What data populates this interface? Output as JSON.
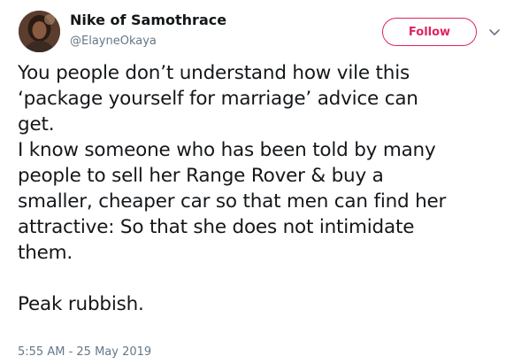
{
  "author": {
    "display_name": "Nike of Samothrace",
    "handle": "@ElayneOkaya"
  },
  "actions": {
    "follow_label": "Follow",
    "caret_icon": "chevron-down-icon"
  },
  "tweet": {
    "lines": [
      "You people don’t understand how vile this",
      "‘package yourself for marriage’ advice can",
      "get.",
      "I know someone who has been told by many",
      "people to sell her Range Rover & buy a",
      "smaller, cheaper car so that men can find her",
      "attractive: So that she does not intimidate",
      "them."
    ],
    "closing": "Peak rubbish.",
    "timestamp": "5:55 AM - 25 May 2019"
  },
  "colors": {
    "follow_accent": "#e0245e",
    "text_primary": "#14171a",
    "text_secondary": "#657786"
  }
}
